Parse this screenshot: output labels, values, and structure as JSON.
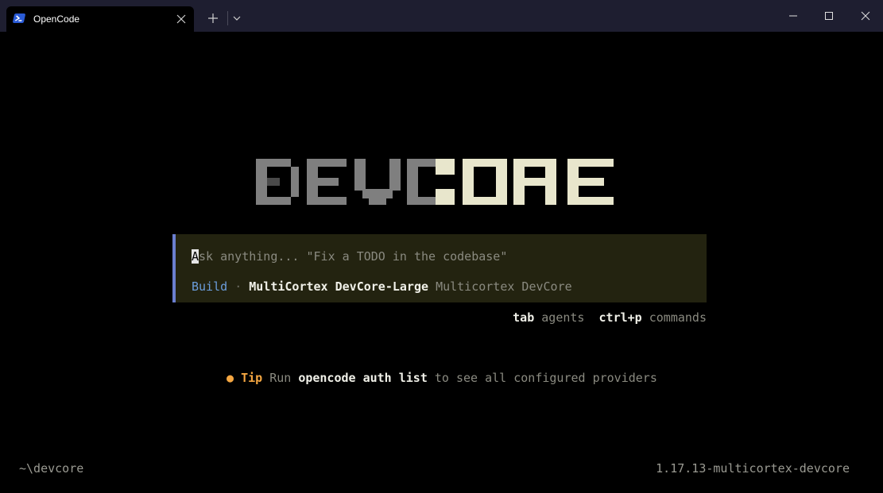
{
  "window": {
    "tab_title": "OpenCode",
    "tab_icon": "powershell-icon"
  },
  "logo": {
    "text_dim": "DEV",
    "text_bright": "CORE",
    "color_dim": "#7f7f7f",
    "color_bright": "#e8e6cc"
  },
  "prompt": {
    "cursor_char": "A",
    "placeholder_rest": "sk anything... \"Fix a TODO in the codebase\"",
    "agent": "Build",
    "separator": "·",
    "model": "MultiCortex DevCore-Large",
    "provider": "Multicortex DevCore"
  },
  "hints": [
    {
      "key": "tab",
      "label": "agents"
    },
    {
      "key": "ctrl+p",
      "label": "commands"
    }
  ],
  "tip": {
    "bullet": "●",
    "label": "Tip",
    "before": "Run",
    "command": "opencode auth list",
    "after": "to see all configured providers"
  },
  "status": {
    "cwd": "~\\devcore",
    "version": "1.17.13-multicortex-devcore"
  },
  "colors": {
    "background": "#000000",
    "titlebar": "#1e1e30",
    "prompt_bg": "#232310",
    "prompt_border": "#6b7fd0",
    "agent": "#6b9ddb",
    "tip": "#f5a742"
  }
}
